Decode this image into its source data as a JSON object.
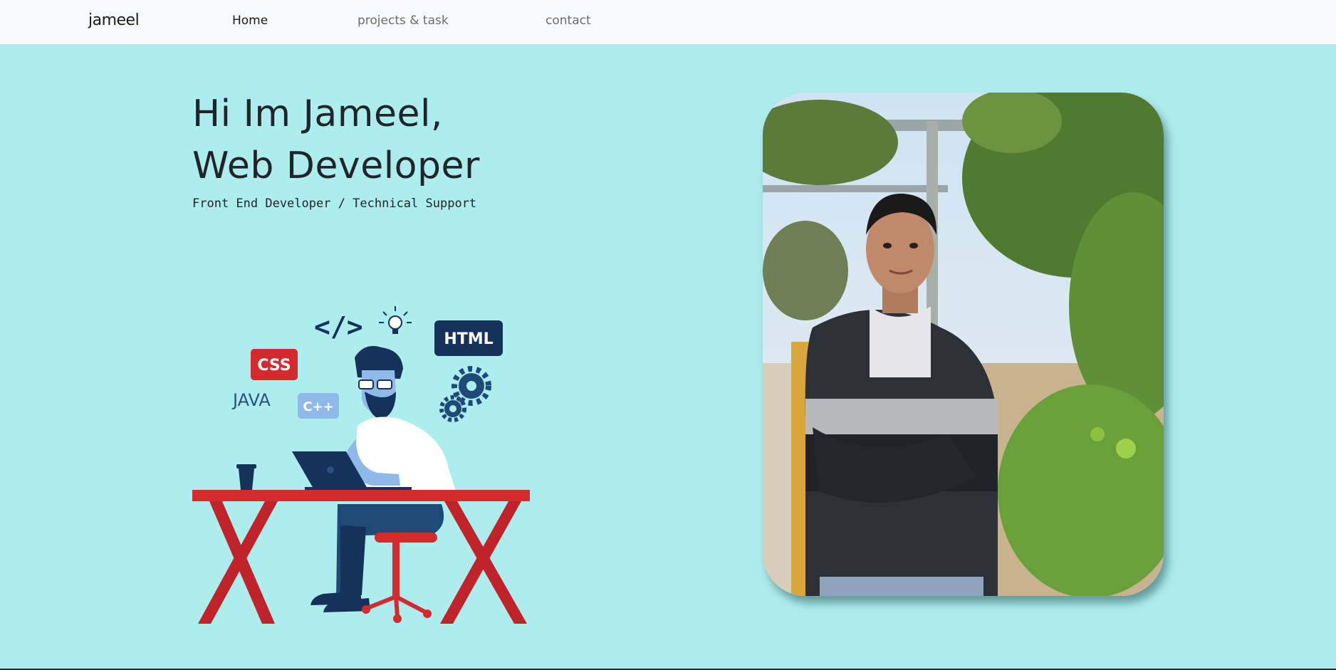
{
  "navbar": {
    "brand": "jameel",
    "links": [
      {
        "label": "Home"
      },
      {
        "label": "projects & task"
      },
      {
        "label": "contact"
      }
    ]
  },
  "hero": {
    "title_line1": "Hi Im Jameel,",
    "title_line2": "Web Developer",
    "subtitle": "Front End Developer / Technical Support"
  },
  "illustration": {
    "labels": {
      "css": "CSS",
      "html": "HTML",
      "java": "JAVA",
      "cpp": "C++",
      "code": "</>"
    }
  },
  "colors": {
    "page_background": "#aeedee",
    "navbar_background": "#f8f9fa",
    "desk_red": "#d42a2e",
    "navy": "#15325b"
  }
}
